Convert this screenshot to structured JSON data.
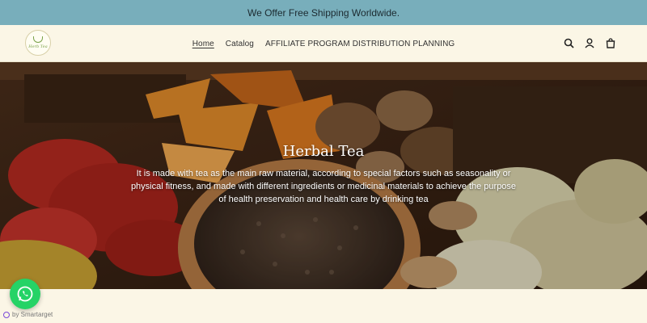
{
  "announcement": {
    "text": "We Offer Free Shipping Worldwide."
  },
  "header": {
    "logo_icon": "tea-cup-logo",
    "logo_text": "Herb Tea",
    "nav": [
      {
        "label": "Home",
        "active": true
      },
      {
        "label": "Catalog",
        "active": false
      },
      {
        "label": "AFFILIATE PROGRAM DISTRIBUTION PLANNING",
        "active": false
      }
    ],
    "icons": [
      "search-icon",
      "user-icon",
      "cart-icon"
    ]
  },
  "hero": {
    "title": "Herbal Tea",
    "description": "It is made with tea as the main raw material, according to special factors such as seasonality or physical fitness, and made with different ingredients or medicinal materials to achieve the purpose of health preservation and health care by drinking tea"
  },
  "widgets": {
    "whatsapp_icon": "whatsapp-icon",
    "powered_by": "by Smartarget"
  },
  "colors": {
    "announcement_bg": "#78aebb",
    "page_bg": "#fbf6e6",
    "whatsapp": "#25d366"
  }
}
